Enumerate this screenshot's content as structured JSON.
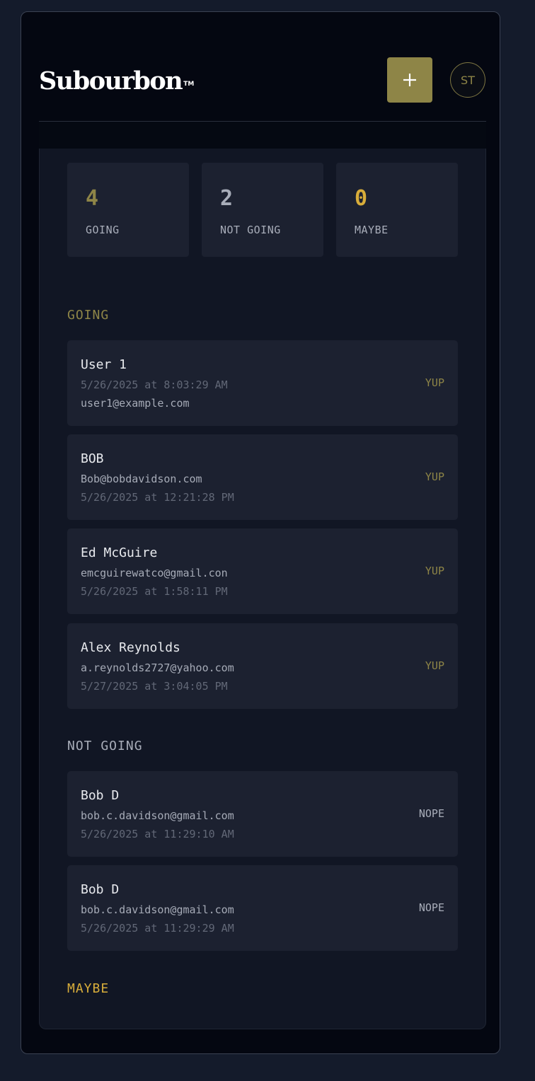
{
  "header": {
    "logo": "Subourbon",
    "trademark": "TM",
    "add_label": "+",
    "avatar_initials": "ST"
  },
  "stats": [
    {
      "value": "4",
      "label": "GOING",
      "color": "#8e8547"
    },
    {
      "value": "2",
      "label": "NOT GOING",
      "color": "#a8adb9"
    },
    {
      "value": "0",
      "label": "MAYBE",
      "color": "#d8ad3a"
    }
  ],
  "sections": {
    "going": {
      "title": "GOING",
      "color": "#8e8547"
    },
    "not_going": {
      "title": "NOT GOING",
      "color": "#a8adb9"
    },
    "maybe": {
      "title": "MAYBE",
      "color": "#d8ad3a"
    }
  },
  "going": [
    {
      "name": "User 1",
      "line1": "5/26/2025 at 8:03:29 AM",
      "line2": "user1@example.com",
      "status": "YUP"
    },
    {
      "name": "BOB",
      "line1": "Bob@bobdavidson.com",
      "line2": "5/26/2025 at 12:21:28 PM",
      "status": "YUP"
    },
    {
      "name": "Ed McGuire",
      "line1": "emcguirewatco@gmail.con",
      "line2": "5/26/2025 at 1:58:11 PM",
      "status": "YUP"
    },
    {
      "name": "Alex Reynolds",
      "line1": "a.reynolds2727@yahoo.com",
      "line2": "5/27/2025 at 3:04:05 PM",
      "status": "YUP"
    }
  ],
  "not_going": [
    {
      "name": "Bob D",
      "line1": "bob.c.davidson@gmail.com",
      "line2": "5/26/2025 at 11:29:10 AM",
      "status": "NOPE"
    },
    {
      "name": "Bob D",
      "line1": "bob.c.davidson@gmail.com",
      "line2": "5/26/2025 at 11:29:29 AM",
      "status": "NOPE"
    }
  ],
  "colors": {
    "yup": "#8e8547",
    "nope": "#a8adb9"
  }
}
